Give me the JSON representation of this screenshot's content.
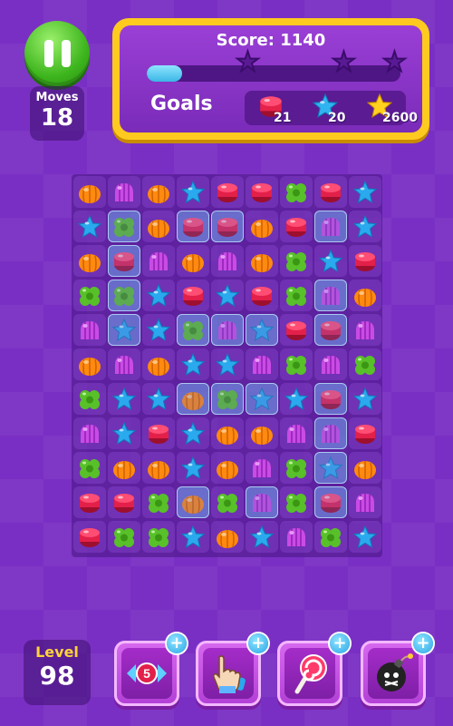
{
  "hud": {
    "moves_label": "Moves",
    "moves_value": "18",
    "score_text": "Score: 1140",
    "score_progress": 0.14,
    "progress_stars": [
      "star-1",
      "star-2",
      "star-3"
    ],
    "goals_label": "Goals",
    "goals": [
      {
        "icon": "red-jelly",
        "count": "21",
        "color": "#e5234a"
      },
      {
        "icon": "blue-star",
        "count": "20",
        "color": "#31b3ef"
      },
      {
        "icon": "gold-star",
        "count": "2600",
        "color": "#ffd21f"
      }
    ]
  },
  "board": {
    "candy_colors": {
      "orange": "#ff8a10",
      "purple": "#c94be6",
      "blue": "#2aa9ee",
      "red": "#e2204a",
      "green": "#58c029"
    },
    "rows": [
      [
        "orange",
        "purple",
        "orange",
        "blue",
        "red",
        "red",
        "green",
        "red",
        "blue"
      ],
      [
        "blue",
        "green",
        "orange",
        "red",
        "red",
        "orange",
        "red",
        "purple",
        "blue"
      ],
      [
        "orange",
        "red",
        "purple",
        "orange",
        "purple",
        "orange",
        "green",
        "blue",
        "red"
      ],
      [
        "green",
        "green",
        "blue",
        "red",
        "blue",
        "red",
        "green",
        "purple",
        "orange"
      ],
      [
        "purple",
        "blue",
        "blue",
        "green",
        "purple",
        "blue",
        "red",
        "red",
        "purple"
      ],
      [
        "orange",
        "purple",
        "orange",
        "blue",
        "blue",
        "purple",
        "green",
        "purple",
        "green"
      ],
      [
        "green",
        "blue",
        "blue",
        "orange",
        "green",
        "blue",
        "blue",
        "red",
        "blue"
      ],
      [
        "purple",
        "blue",
        "red",
        "blue",
        "orange",
        "orange",
        "purple",
        "purple",
        "red"
      ],
      [
        "green",
        "orange",
        "orange",
        "blue",
        "orange",
        "purple",
        "green",
        "blue",
        "orange"
      ],
      [
        "red",
        "red",
        "green",
        "orange",
        "green",
        "purple",
        "green",
        "red",
        "purple"
      ],
      [
        "red",
        "green",
        "green",
        "blue",
        "orange",
        "blue",
        "purple",
        "green",
        "blue"
      ]
    ],
    "ice": [
      [
        1,
        1
      ],
      [
        1,
        3
      ],
      [
        1,
        4
      ],
      [
        1,
        7
      ],
      [
        2,
        1
      ],
      [
        3,
        1
      ],
      [
        3,
        7
      ],
      [
        4,
        1
      ],
      [
        4,
        3
      ],
      [
        4,
        4
      ],
      [
        4,
        5
      ],
      [
        4,
        7
      ],
      [
        6,
        3
      ],
      [
        6,
        4
      ],
      [
        6,
        5
      ],
      [
        6,
        7
      ],
      [
        7,
        7
      ],
      [
        8,
        7
      ],
      [
        9,
        3
      ],
      [
        9,
        5
      ],
      [
        9,
        7
      ]
    ]
  },
  "footer": {
    "level_label": "Level",
    "level_value": "98",
    "boosters": [
      {
        "name": "extra-moves",
        "badge_text": "5"
      },
      {
        "name": "hand-swap"
      },
      {
        "name": "lollipop-hammer"
      },
      {
        "name": "bomb"
      }
    ],
    "plus_symbol": "+"
  }
}
